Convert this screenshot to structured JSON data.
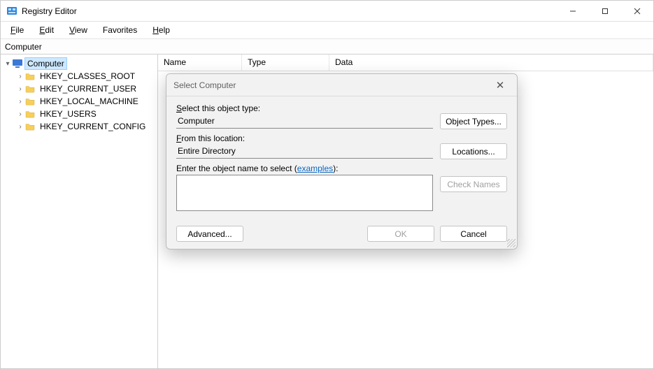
{
  "window": {
    "title": "Registry Editor"
  },
  "menubar": {
    "file": "File",
    "edit": "Edit",
    "view": "View",
    "favorites": "Favorites",
    "help": "Help"
  },
  "address": "Computer",
  "tree": {
    "root": "Computer",
    "hives": [
      "HKEY_CLASSES_ROOT",
      "HKEY_CURRENT_USER",
      "HKEY_LOCAL_MACHINE",
      "HKEY_USERS",
      "HKEY_CURRENT_CONFIG"
    ]
  },
  "columns": {
    "name": "Name",
    "type": "Type",
    "data": "Data"
  },
  "dialog": {
    "title": "Select Computer",
    "object_type_label": "Select this object type:",
    "object_type_value": "Computer",
    "object_types_btn": "Object Types...",
    "location_label": "From this location:",
    "location_value": "Entire Directory",
    "locations_btn": "Locations...",
    "enter_label_pre": "Enter the object name to select (",
    "enter_label_link": "examples",
    "enter_label_post": "):",
    "object_name_value": "",
    "check_names_btn": "Check Names",
    "advanced_btn": "Advanced...",
    "ok_btn": "OK",
    "cancel_btn": "Cancel"
  }
}
